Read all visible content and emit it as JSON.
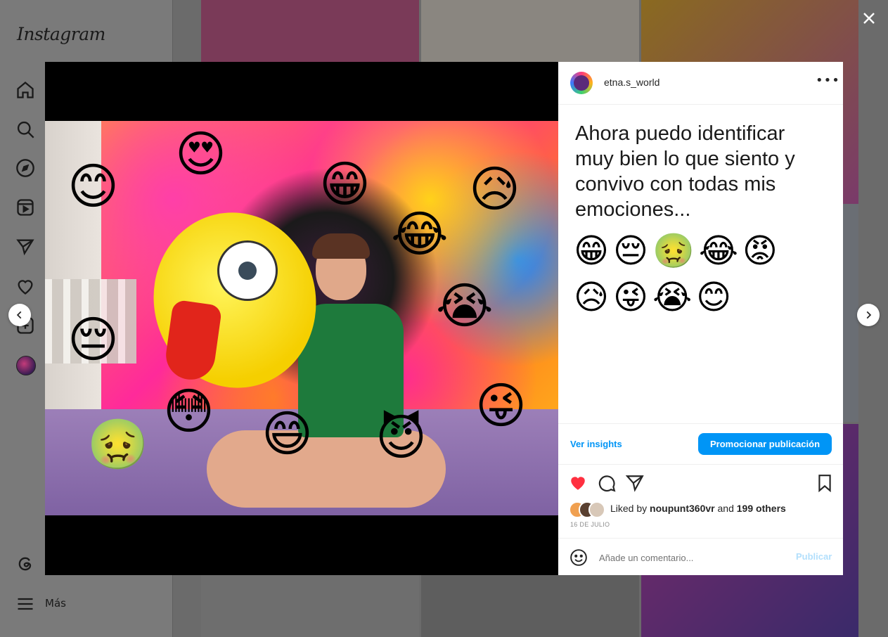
{
  "sidebar": {
    "logo": "Instagram",
    "items": [
      {
        "name": "home",
        "icon": "home-icon"
      },
      {
        "name": "search",
        "icon": "search-icon"
      },
      {
        "name": "explore",
        "icon": "compass-icon"
      },
      {
        "name": "reels",
        "icon": "reels-icon"
      },
      {
        "name": "messages",
        "icon": "paper-plane-icon"
      },
      {
        "name": "notifications",
        "icon": "heart-icon"
      },
      {
        "name": "create",
        "icon": "plus-square-icon"
      },
      {
        "name": "profile",
        "icon": "avatar"
      }
    ],
    "threads_icon": "threads-icon",
    "more_label": "Más"
  },
  "modal": {
    "close_icon": "close-icon",
    "prev_icon": "chevron-left-icon",
    "next_icon": "chevron-right-icon"
  },
  "post": {
    "username": "etna.s_world",
    "caption": "Ahora puedo identificar muy bien lo que siento y convivo con todas mis emociones...",
    "caption_emojis": "😁😔🤢😂😡😥😜😭😊",
    "ver_insights": "Ver insights",
    "promote_label": "Promocionar publicación",
    "liked_by_prefix": "Liked by",
    "liked_by_user": "noupunt360vr",
    "liked_by_and": "and",
    "liked_by_others": "199 others",
    "date": "16 DE JULIO",
    "comment_placeholder": "Añade un comentario...",
    "publish_label": "Publicar"
  },
  "colors": {
    "accent": "#0095f6",
    "like_red": "#ff3040",
    "overlay": "#6b6b6b"
  }
}
